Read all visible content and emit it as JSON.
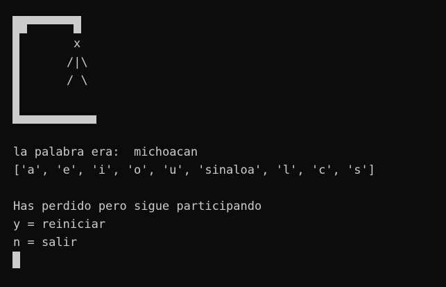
{
  "colors": {
    "background": "#0c0c0c",
    "foreground": "#cccccc"
  },
  "hangman": {
    "head": "x",
    "torso": "/|\\",
    "legs": "/ \\"
  },
  "output": {
    "word_line_label": "la palabra era:",
    "word": "michoacan",
    "guesses_line": "['a', 'e', 'i', 'o', 'u', 'sinaloa', 'l', 'c', 's']",
    "lost_message": "Has perdido pero sigue participando",
    "option_restart": "y = reiniciar",
    "option_quit": "n = salir"
  }
}
